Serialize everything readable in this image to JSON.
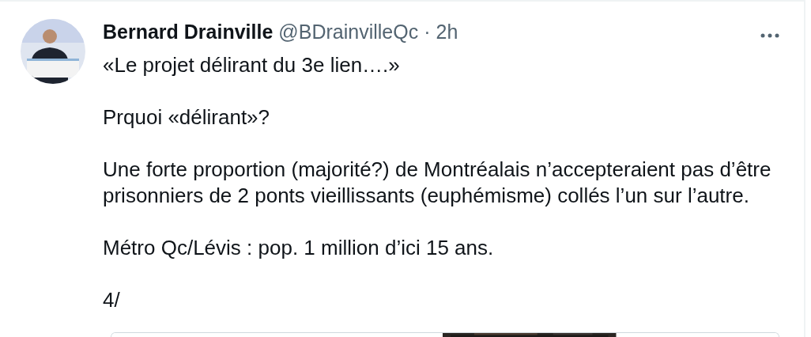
{
  "tweet": {
    "author_name": "Bernard Drainville",
    "handle": "@BDrainvilleQc",
    "separator": "·",
    "time": "2h",
    "paragraphs": [
      "«Le projet délirant du 3e lien….»",
      "Prquoi «délirant»?",
      "Une forte proportion (majorité?) de Montréalais n’accepteraient pas d’être prisonniers de 2 ponts vieillissants (euphémisme) collés l’un sur l’autre.",
      "Métro Qc/Lévis : pop. 1 million d’ici 15 ans.",
      "4/"
    ]
  }
}
